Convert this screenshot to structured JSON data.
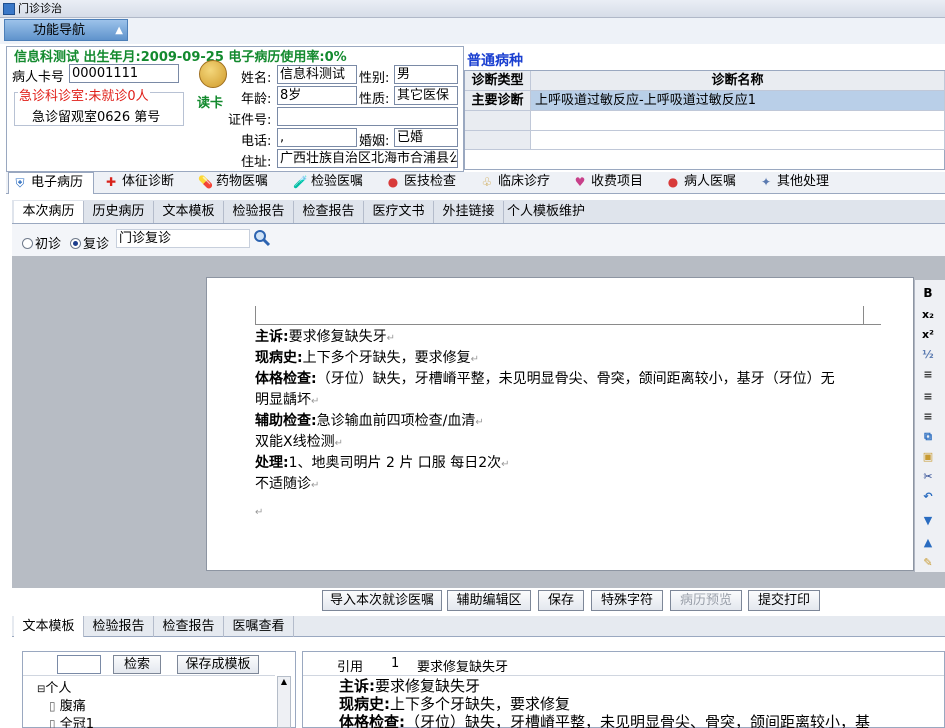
{
  "window": {
    "title": "门诊诊治"
  },
  "nav": {
    "label": "功能导航"
  },
  "patient": {
    "header": "信息科测试 出生年月:2009-09-25 电子病历使用率:0%",
    "card_label": "病人卡号",
    "card_no": "00001111",
    "room_status": "急诊科诊室:未就诊0人",
    "room_info": "急诊留观室0626  第号",
    "read_card": "读卡",
    "name_label": "姓名:",
    "name": "信息科测试",
    "gender_label": "性别:",
    "gender": "男",
    "age_label": "年龄:",
    "age": "8岁",
    "nature_label": "性质:",
    "nature": "其它医保",
    "id_label": "证件号:",
    "id_value": "",
    "phone_label": "电话:",
    "phone": ",",
    "marriage_label": "婚姻:",
    "marriage": "已婚",
    "address_label": "住址:",
    "address": "广西壮族自治区北海市合浦县公"
  },
  "diagnosis": {
    "title": "普通病种",
    "col_type": "诊断类型",
    "col_name": "诊断名称",
    "rows": [
      {
        "type": "主要诊断",
        "name": "上呼吸道过敏反应-上呼吸道过敏反应1"
      }
    ]
  },
  "main_tabs": [
    "电子病历",
    "体征诊断",
    "药物医嘱",
    "检验医嘱",
    "医技检查",
    "临床诊疗",
    "收费项目",
    "病人医嘱",
    "其他处理"
  ],
  "sub_tabs": [
    "本次病历",
    "历史病历",
    "文本模板",
    "检验报告",
    "检查报告",
    "医疗文书",
    "外挂链接",
    "个人模板维护"
  ],
  "visit": {
    "first": "初诊",
    "return": "复诊",
    "type_value": "门诊复诊"
  },
  "record": {
    "complaint_label": "主诉:",
    "complaint": "要求修复缺失牙",
    "history_label": "现病史:",
    "history": "上下多个牙缺失，要求修复",
    "exam_label": "体格检查:",
    "exam_line1": "（牙位）缺失，牙槽嵴平整，未见明显骨尖、骨突，颌间距离较小，基牙（牙位）无",
    "exam_line2": "明显龋坏",
    "aux_label": "辅助检查:",
    "aux_line1": "急诊输血前四项检查/血清",
    "aux_line2": "双能X线检测",
    "treat_label": "处理:",
    "treat_line1": "1、地奥司明片 2 片 口服 每日2次",
    "treat_line2": "不适随诊",
    "para_mark": "↵"
  },
  "actions": [
    "导入本次就诊医嘱",
    "辅助编辑区",
    "保存",
    "特殊字符",
    "病历预览",
    "提交打印"
  ],
  "bottom_tabs": [
    "文本模板",
    "检验报告",
    "检查报告",
    "医嘱查看"
  ],
  "template_panel": {
    "search_value": "",
    "search_label": "检索",
    "save_label": "保存成模板",
    "tree": [
      "个人",
      "腹痛",
      "全冠1"
    ]
  },
  "preview": {
    "ref_label": "引用",
    "ref_no": "1",
    "ref_title": "要求修复缺失牙",
    "lines": [
      {
        "label": "主诉:",
        "text": "要求修复缺失牙"
      },
      {
        "label": "现病史:",
        "text": "上下多个牙缺失，要求修复"
      },
      {
        "label": "体格检查:",
        "text": "（牙位）缺失，牙槽嵴平整，未见明显骨尖、骨突，颌间距离较小，基"
      }
    ]
  }
}
